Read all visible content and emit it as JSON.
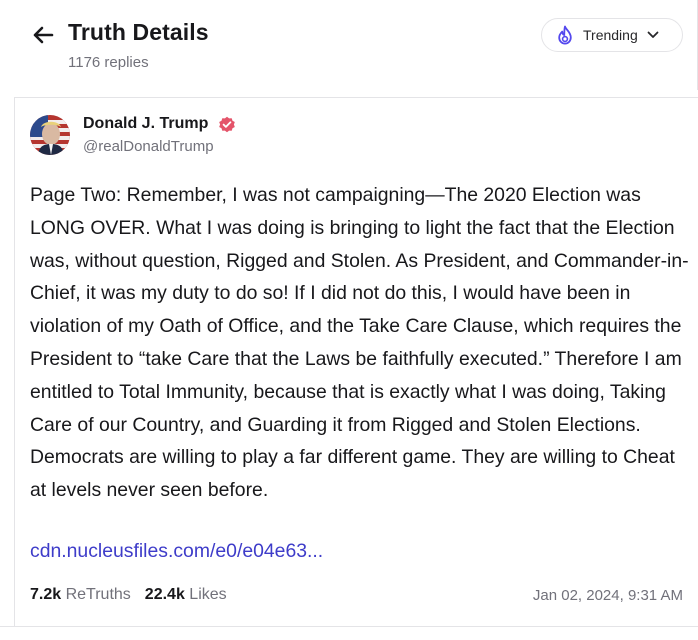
{
  "header": {
    "title": "Truth Details",
    "replies": "1176 replies",
    "trending_label": "Trending"
  },
  "post": {
    "author_name": "Donald J. Trump",
    "author_handle": "@realDonaldTrump",
    "text": "Page Two: Remember, I was not campaigning—The 2020 Election was LONG OVER. What I was doing is bringing to light the fact that the Election was, without question, Rigged and Stolen. As President, and Commander-in-Chief, it was my duty to do so! If I did not do this, I would have been in violation of my Oath of Office, and the Take Care Clause, which requires the President to “take Care that the Laws be faithfully executed.” Therefore I am entitled to Total Immunity, because that is exactly what I was doing, Taking Care of our Country, and Guarding it from Rigged and Stolen Elections. Democrats are willing to play a far different game. They are willing to Cheat at levels never seen before.",
    "link": "cdn.nucleusfiles.com/e0/e04e63...",
    "retruths_count": "7.2k",
    "retruths_label": "ReTruths",
    "likes_count": "22.4k",
    "likes_label": "Likes",
    "timestamp": "Jan 02, 2024, 9:31 AM"
  },
  "colors": {
    "accent": "#5448ee",
    "link": "#3e3cc9",
    "verified": "#e4546a",
    "muted": "#71717a",
    "border": "#e4e4e7"
  }
}
